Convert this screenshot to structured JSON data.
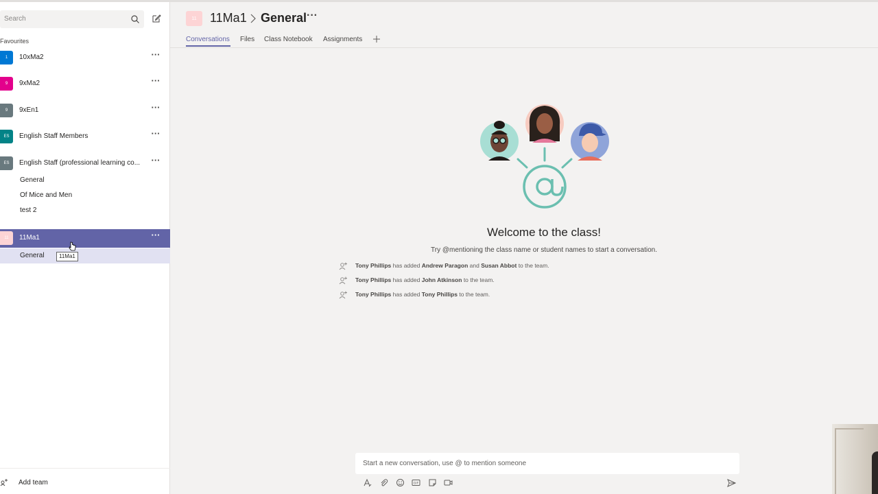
{
  "sidebar": {
    "search": {
      "placeholder": "Search"
    },
    "favourites_label": "Favourites",
    "teams": [
      {
        "name": "10xMa2",
        "tile": "1",
        "color": "#0078d4"
      },
      {
        "name": "9xMa2",
        "tile": "9",
        "color": "#e3008c"
      },
      {
        "name": "9xEn1",
        "tile": "9",
        "color": "#69797e"
      },
      {
        "name": "English Staff Members",
        "tile": "ES",
        "color": "#038387"
      },
      {
        "name": "English Staff (professional learning co...",
        "tile": "ES",
        "color": "#69797e",
        "channels": [
          "General",
          "Of Mice and Men",
          "test 2"
        ]
      },
      {
        "name": "11Ma1",
        "tile": "11",
        "color": "#fdd4d5",
        "channels": [
          "General"
        ]
      }
    ],
    "tooltip": "11Ma1",
    "add_team": "Add team"
  },
  "header": {
    "team": "11Ma1",
    "channel": "General",
    "tabs": [
      "Conversations",
      "Files",
      "Class Notebook",
      "Assignments"
    ],
    "active_tab": "Conversations",
    "accent": "#6264a7"
  },
  "welcome": {
    "title": "Welcome to the class!",
    "subtitle": "Try @mentioning the class name or student names to start a conversation."
  },
  "activity": [
    {
      "actor": "Tony Phillips",
      "verb": "has added",
      "added1": "Andrew Paragon",
      "joiner": "and",
      "added2": "Susan Abbot",
      "tail": "to the team."
    },
    {
      "actor": "Tony Phillips",
      "verb": "has added",
      "added1": "John Atkinson",
      "tail": "to the team."
    },
    {
      "actor": "Tony Phillips",
      "verb": "has added",
      "added1": "Tony Phillips",
      "tail": "to the team."
    }
  ],
  "compose": {
    "placeholder": "Start a new conversation, use @ to mention someone"
  }
}
